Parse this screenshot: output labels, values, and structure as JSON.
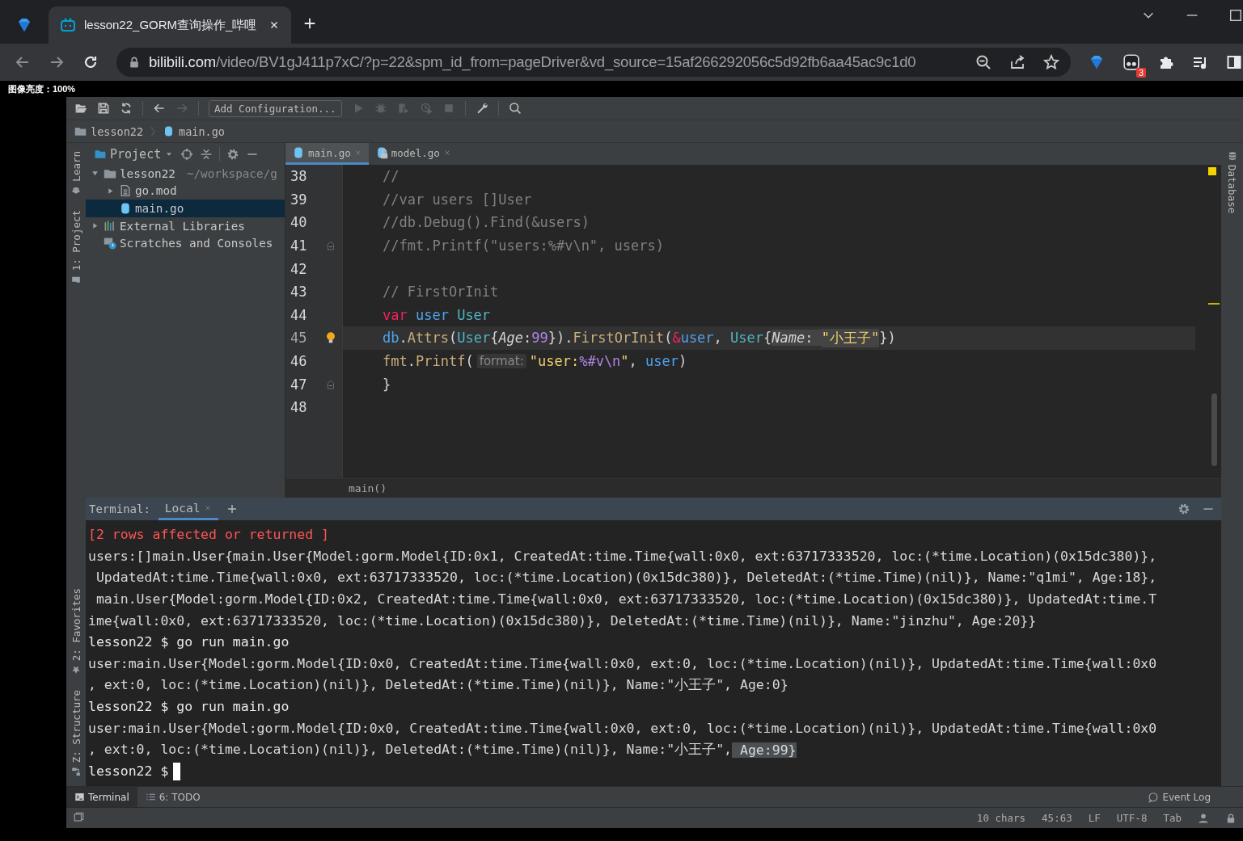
{
  "browser": {
    "tabs": [
      {
        "title": "lesson22_GORM查询操作_哔哩",
        "selected": true
      }
    ],
    "url": {
      "host": "bilibili.com",
      "path": "/video/BV1gJ411p7xC/?p=22&spm_id_from=pageDriver&vd_source=15af266292056c5d92fb6aa45ac9c1d0"
    },
    "extension_badge": "3"
  },
  "brightness_label": "图像亮度：100%",
  "ide": {
    "toolbar": {
      "buttons": [
        {
          "kind": "open",
          "disabled": false
        },
        {
          "kind": "save",
          "disabled": false
        },
        {
          "kind": "sync",
          "disabled": false
        },
        {
          "kind": "back",
          "disabled": false
        },
        {
          "kind": "forward",
          "disabled": true
        }
      ],
      "run_config": "Add Configuration...",
      "run_buttons": [
        {
          "kind": "run",
          "disabled": true
        },
        {
          "kind": "debug",
          "disabled": true
        },
        {
          "kind": "coverage",
          "disabled": true
        },
        {
          "kind": "profile",
          "disabled": true
        },
        {
          "kind": "stop",
          "disabled": true
        },
        {
          "kind": "wrench",
          "disabled": false
        },
        {
          "kind": "search",
          "disabled": false
        }
      ]
    },
    "breadcrumb": [
      {
        "label": "lesson22",
        "kind": "folder"
      },
      {
        "label": "main.go",
        "kind": "go"
      }
    ],
    "left_tools_top": [
      "Learn",
      "1: Project"
    ],
    "left_tools_bottom": [
      "2: Favorites",
      "Z: Structure"
    ],
    "right_tools": [
      "Database"
    ],
    "project": {
      "title": "Project",
      "tree": [
        {
          "label": "lesson22",
          "kind": "folder",
          "path": "~/workspace/g",
          "expanded": true,
          "selected": false,
          "children": [
            {
              "label": "go.mod",
              "kind": "file",
              "expanded": false,
              "selected": false
            },
            {
              "label": "main.go",
              "kind": "go",
              "selected": true
            }
          ]
        },
        {
          "label": "External Libraries",
          "kind": "library",
          "expanded": false,
          "selected": false
        },
        {
          "label": "Scratches and Consoles",
          "kind": "scratch",
          "selected": false
        }
      ]
    },
    "editor": {
      "tabs": [
        {
          "label": "main.go",
          "selected": true,
          "kind": "go"
        },
        {
          "label": "model.go",
          "selected": false,
          "kind": "go-readonly"
        }
      ],
      "lines": [
        {
          "number": "38",
          "current": false,
          "kind": "plain",
          "tokens": [
            {
              "text": "//",
              "kind": "comment"
            }
          ]
        },
        {
          "number": "39",
          "current": false,
          "kind": "plain",
          "tokens": [
            {
              "text": "//var users []User",
              "kind": "comment"
            }
          ]
        },
        {
          "number": "40",
          "current": false,
          "kind": "plain",
          "tokens": [
            {
              "text": "//db.Debug().Find(&users)",
              "kind": "comment"
            }
          ]
        },
        {
          "number": "41",
          "current": false,
          "kind": "fold",
          "tokens": [
            {
              "text": "//fmt.Printf(\"users:%#v\\n\", users)",
              "kind": "comment"
            }
          ]
        },
        {
          "number": "42",
          "current": false,
          "kind": "plain"
        },
        {
          "number": "43",
          "current": false,
          "kind": "plain",
          "tokens": [
            {
              "text": "// FirstOrInit",
              "kind": "comment"
            }
          ]
        },
        {
          "number": "44",
          "current": false,
          "kind": "plain",
          "tokens": [
            {
              "text": "var ",
              "kind": "keyword"
            },
            {
              "text": "user ",
              "kind": "var"
            },
            {
              "text": "User",
              "kind": "type"
            }
          ]
        },
        {
          "number": "45",
          "current": true,
          "kind": "bulb",
          "tokens": [
            {
              "text": "db",
              "kind": "var"
            },
            {
              "text": ".",
              "kind": "plain"
            },
            {
              "text": "Attrs",
              "kind": "fn"
            },
            {
              "text": "(",
              "kind": "plain"
            },
            {
              "text": "User",
              "kind": "type"
            },
            {
              "text": "{",
              "kind": "plain"
            },
            {
              "text": "Age",
              "kind": "field"
            },
            {
              "text": ":",
              "kind": "plain"
            },
            {
              "text": "99",
              "kind": "number"
            },
            {
              "text": "}).",
              "kind": "plain"
            },
            {
              "text": "FirstOrInit",
              "kind": "fn"
            },
            {
              "text": "(",
              "kind": "plain"
            },
            {
              "text": "&",
              "kind": "keyword"
            },
            {
              "text": "user",
              "kind": "var"
            },
            {
              "text": ", ",
              "kind": "plain"
            },
            {
              "text": "User",
              "kind": "type"
            },
            {
              "text": "{",
              "kind": "plain"
            },
            {
              "text": "Name",
              "kind": "field-marked"
            },
            {
              "text": ": ",
              "kind": "marked"
            },
            {
              "text": "\"小王子\"",
              "kind": "string-marked"
            },
            {
              "text": "})",
              "kind": "plain"
            }
          ]
        },
        {
          "number": "46",
          "current": false,
          "kind": "plain",
          "tokens": [
            {
              "text": "fmt",
              "kind": "pkg"
            },
            {
              "text": ".",
              "kind": "plain"
            },
            {
              "text": "Printf",
              "kind": "fn"
            },
            {
              "text": "(",
              "kind": "plain"
            },
            {
              "text": "format:",
              "kind": "hint"
            },
            {
              "text": "\"user:",
              "kind": "string"
            },
            {
              "text": "%#v\\n",
              "kind": "escape"
            },
            {
              "text": "\"",
              "kind": "string"
            },
            {
              "text": ", ",
              "kind": "plain"
            },
            {
              "text": "user",
              "kind": "var"
            },
            {
              "text": ")",
              "kind": "plain"
            }
          ]
        },
        {
          "number": "47",
          "current": false,
          "kind": "fold",
          "tokens": [
            {
              "text": "}",
              "kind": "plain"
            }
          ]
        },
        {
          "number": "48",
          "current": false,
          "kind": "plain"
        }
      ],
      "footer": "main()"
    },
    "terminal": {
      "title": "Terminal:",
      "tabs": [
        {
          "label": "Local",
          "selected": true
        }
      ],
      "lines": [
        {
          "kind": "error",
          "text": "[2 rows affected or returned ]"
        },
        {
          "kind": "output",
          "text": "users:[]main.User{main.User{Model:gorm.Model{ID:0x1, CreatedAt:time.Time{wall:0x0, ext:63717333520, loc:(*time.Location)(0x15dc380)},"
        },
        {
          "kind": "output",
          "text": " UpdatedAt:time.Time{wall:0x0, ext:63717333520, loc:(*time.Location)(0x15dc380)}, DeletedAt:(*time.Time)(nil)}, Name:\"q1mi\", Age:18},"
        },
        {
          "kind": "output",
          "text": " main.User{Model:gorm.Model{ID:0x2, CreatedAt:time.Time{wall:0x0, ext:63717333520, loc:(*time.Location)(0x15dc380)}, UpdatedAt:time.T"
        },
        {
          "kind": "output",
          "text": "ime{wall:0x0, ext:63717333520, loc:(*time.Location)(0x15dc380)}, DeletedAt:(*time.Time)(nil)}, Name:\"jinzhu\", Age:20}}"
        },
        {
          "kind": "prompt",
          "text": "lesson22 $ go run main.go"
        },
        {
          "kind": "output",
          "text": "user:main.User{Model:gorm.Model{ID:0x0, CreatedAt:time.Time{wall:0x0, ext:0, loc:(*time.Location)(nil)}, UpdatedAt:time.Time{wall:0x0"
        },
        {
          "kind": "output",
          "text": ", ext:0, loc:(*time.Location)(nil)}, DeletedAt:(*time.Time)(nil)}, Name:\"小王子\", Age:0}"
        },
        {
          "kind": "prompt",
          "text": "lesson22 $ go run main.go"
        },
        {
          "kind": "output",
          "text": "user:main.User{Model:gorm.Model{ID:0x0, CreatedAt:time.Time{wall:0x0, ext:0, loc:(*time.Location)(nil)}, UpdatedAt:time.Time{wall:0x0"
        },
        {
          "kind": "output",
          "segments": [
            {
              "text": ", ext:0, loc:(*time.Location)(nil)}, DeletedAt:(*time.Time)(nil)}, Name:\"小王子\",",
              "selected": false
            },
            {
              "text": " Age:99}",
              "selected": true
            }
          ]
        },
        {
          "kind": "prompt",
          "text": "lesson22 $",
          "cursor": true
        }
      ]
    },
    "bottom_tools": [
      {
        "label": "Terminal",
        "kind": "terminal",
        "selected": true
      },
      {
        "label": "6: TODO",
        "kind": "todo",
        "selected": false
      }
    ],
    "event_log": "Event Log",
    "status": [
      "10 chars",
      "45:63",
      "LF",
      "UTF-8",
      "Tab"
    ]
  }
}
